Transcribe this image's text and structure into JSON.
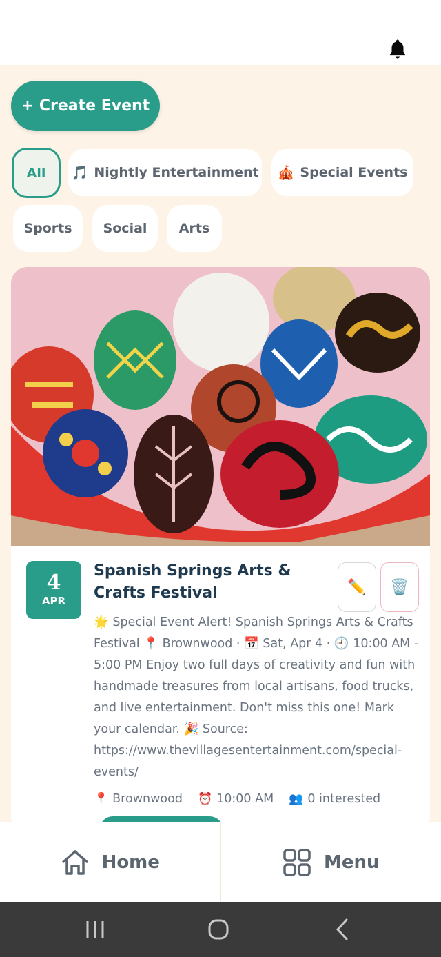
{
  "header": {
    "notifications_icon": "bell-icon"
  },
  "actions": {
    "create_event_label": "+ Create Event"
  },
  "filters": [
    {
      "label": "All",
      "emoji": "",
      "active": true
    },
    {
      "label": "Nightly Entertainment",
      "emoji": "🎵",
      "active": false
    },
    {
      "label": "Special Events",
      "emoji": "🎪",
      "active": false
    },
    {
      "label": "Sports",
      "emoji": "",
      "active": false
    },
    {
      "label": "Social",
      "emoji": "",
      "active": false
    },
    {
      "label": "Arts",
      "emoji": "",
      "active": false
    }
  ],
  "event": {
    "day": "4",
    "month": "APR",
    "title": "Spanish Springs Arts & Crafts Festival",
    "edit_emoji": "✏️",
    "delete_emoji": "🗑️",
    "description": "🌟 Special Event Alert! Spanish Springs Arts & Crafts Festival 📍 Brownwood · 📅 Sat, Apr 4 · 🕘 10:00 AM - 5:00 PM Enjoy two full days of creativity and fun with handmade treasures from local artisans, food trucks, and live entertainment. Don't miss this one! Mark your calendar. 🎉 Source: https://www.thevillagesentertainment.com/special-events/",
    "location": "Brownwood",
    "location_emoji": "📍",
    "time": "10:00 AM",
    "time_emoji": "⏰",
    "interested": "0 interested",
    "interested_emoji": "👥"
  },
  "bottom_nav": {
    "home_label": "Home",
    "menu_label": "Menu"
  },
  "colors": {
    "accent": "#2a9d8a",
    "background": "#fdf3e7",
    "title": "#1f3a4f"
  }
}
